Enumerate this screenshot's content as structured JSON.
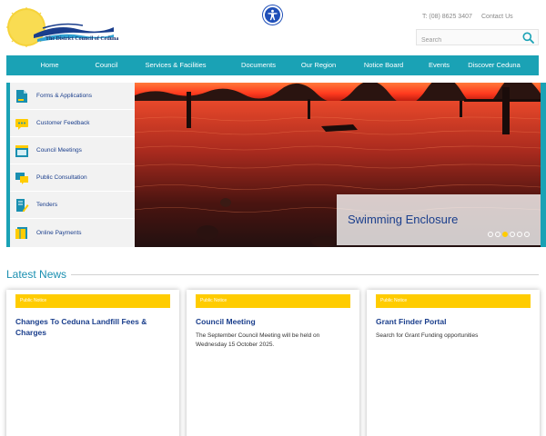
{
  "header": {
    "logo_text": "The District Council of Ceduna",
    "phone": "T: (08) 8625 3407",
    "contact_label": "Contact Us",
    "search_placeholder": "Search"
  },
  "nav": {
    "items": [
      "Home",
      "Council",
      "Services & Facilities",
      "Documents",
      "Our Region",
      "Notice Board",
      "Events",
      "Discover Ceduna"
    ]
  },
  "side_menu": {
    "items": [
      {
        "label": "Forms & Applications",
        "icon": "form-document-icon"
      },
      {
        "label": "Customer Feedback",
        "icon": "chat-bubble-icon"
      },
      {
        "label": "Council Meetings",
        "icon": "meeting-calendar-icon"
      },
      {
        "label": "Public Consultation",
        "icon": "consultation-icon"
      },
      {
        "label": "Tenders",
        "icon": "tender-pencil-icon"
      },
      {
        "label": "Online Payments",
        "icon": "payment-document-icon"
      }
    ]
  },
  "slider": {
    "caption": "Swimming Enclosure",
    "slide_count": 6,
    "active_slide": 3
  },
  "news": {
    "title": "Latest News",
    "cards": [
      {
        "tag": "Public Notice",
        "title": "Changes To Ceduna Landfill Fees & Charges",
        "text": ""
      },
      {
        "tag": "Public Notice",
        "title": "Council Meeting",
        "text": "The September Council Meeting will be held on Wednesday 15 October 2025."
      },
      {
        "tag": "Public Notice",
        "title": "Grant Finder Portal",
        "text": "Search for Grant Funding opportunities"
      }
    ]
  },
  "colors": {
    "accent": "#1aa2b5",
    "brand_navy": "#1a3e8c",
    "tag_yellow": "#ffcc00",
    "access_blue": "#1f4fb8"
  }
}
